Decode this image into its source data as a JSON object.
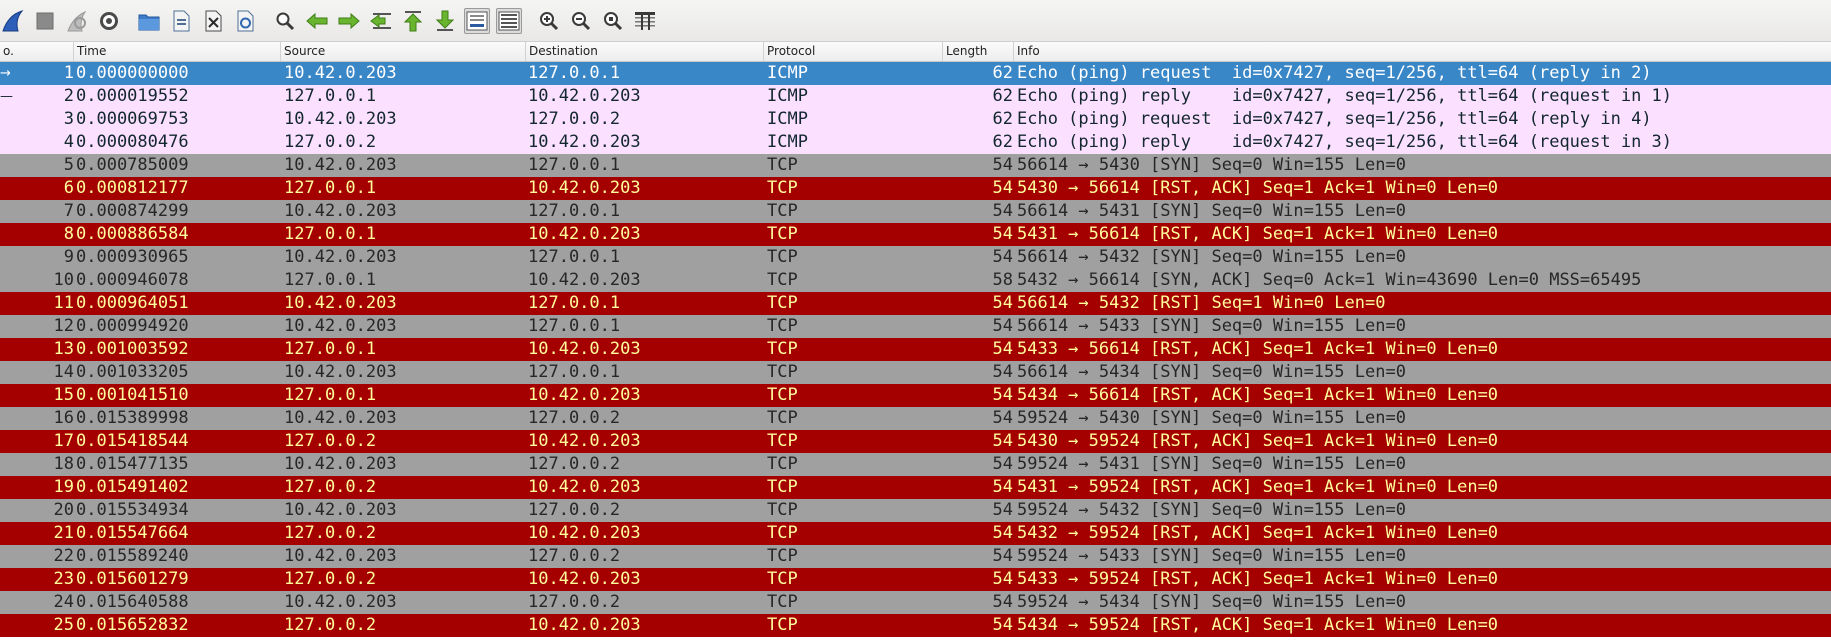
{
  "colors": {
    "selected_bg": "#3a87c8",
    "selected_fg": "#ffffff",
    "icmp_bg": "#fce0ff",
    "icmp_fg": "#12272e",
    "tcp_syn_bg": "#a0a0a0",
    "tcp_syn_fg": "#272727",
    "tcp_rst_bg": "#a40000",
    "tcp_rst_fg": "#fffc9c"
  },
  "toolbar": {
    "buttons": [
      {
        "icon": "shark-fin-start-icon"
      },
      {
        "icon": "stop-capture-icon"
      },
      {
        "icon": "restart-capture-icon"
      },
      {
        "icon": "capture-options-gear-icon"
      },
      {
        "icon": "open-file-folder-icon"
      },
      {
        "icon": "save-file-icon"
      },
      {
        "icon": "close-file-icon"
      },
      {
        "icon": "reload-file-icon"
      },
      {
        "icon": "find-packet-magnifier-icon"
      },
      {
        "icon": "go-back-arrow-icon"
      },
      {
        "icon": "go-forward-arrow-icon"
      },
      {
        "icon": "go-to-packet-icon"
      },
      {
        "icon": "go-to-first-packet-icon"
      },
      {
        "icon": "go-to-last-packet-icon"
      },
      {
        "icon": "auto-scroll-icon"
      },
      {
        "icon": "colorize-packet-list-icon"
      },
      {
        "icon": "zoom-in-icon"
      },
      {
        "icon": "zoom-out-icon"
      },
      {
        "icon": "normal-size-icon"
      },
      {
        "icon": "resize-columns-icon"
      }
    ]
  },
  "columns": [
    "o.",
    "Time",
    "Source",
    "Destination",
    "Protocol",
    "Length",
    "Info"
  ],
  "packets": [
    {
      "no": "1",
      "time": "0.000000000",
      "src": "10.42.0.203",
      "dst": "127.0.0.1",
      "proto": "ICMP",
      "len": "62",
      "info": "Echo (ping) request  id=0x7427, seq=1/256, ttl=64 (reply in 2)",
      "kind": "selected",
      "mark": "→"
    },
    {
      "no": "2",
      "time": "0.000019552",
      "src": "127.0.0.1",
      "dst": "10.42.0.203",
      "proto": "ICMP",
      "len": "62",
      "info": "Echo (ping) reply    id=0x7427, seq=1/256, ttl=64 (request in 1)",
      "kind": "icmp",
      "mark": "—"
    },
    {
      "no": "3",
      "time": "0.000069753",
      "src": "10.42.0.203",
      "dst": "127.0.0.2",
      "proto": "ICMP",
      "len": "62",
      "info": "Echo (ping) request  id=0x7427, seq=1/256, ttl=64 (reply in 4)",
      "kind": "icmp",
      "mark": ""
    },
    {
      "no": "4",
      "time": "0.000080476",
      "src": "127.0.0.2",
      "dst": "10.42.0.203",
      "proto": "ICMP",
      "len": "62",
      "info": "Echo (ping) reply    id=0x7427, seq=1/256, ttl=64 (request in 3)",
      "kind": "icmp",
      "mark": ""
    },
    {
      "no": "5",
      "time": "0.000785009",
      "src": "10.42.0.203",
      "dst": "127.0.0.1",
      "proto": "TCP",
      "len": "54",
      "info": "56614 → 5430 [SYN] Seq=0 Win=155 Len=0",
      "kind": "syn",
      "mark": ""
    },
    {
      "no": "6",
      "time": "0.000812177",
      "src": "127.0.0.1",
      "dst": "10.42.0.203",
      "proto": "TCP",
      "len": "54",
      "info": "5430 → 56614 [RST, ACK] Seq=1 Ack=1 Win=0 Len=0",
      "kind": "rst",
      "mark": ""
    },
    {
      "no": "7",
      "time": "0.000874299",
      "src": "10.42.0.203",
      "dst": "127.0.0.1",
      "proto": "TCP",
      "len": "54",
      "info": "56614 → 5431 [SYN] Seq=0 Win=155 Len=0",
      "kind": "syn",
      "mark": ""
    },
    {
      "no": "8",
      "time": "0.000886584",
      "src": "127.0.0.1",
      "dst": "10.42.0.203",
      "proto": "TCP",
      "len": "54",
      "info": "5431 → 56614 [RST, ACK] Seq=1 Ack=1 Win=0 Len=0",
      "kind": "rst",
      "mark": ""
    },
    {
      "no": "9",
      "time": "0.000930965",
      "src": "10.42.0.203",
      "dst": "127.0.0.1",
      "proto": "TCP",
      "len": "54",
      "info": "56614 → 5432 [SYN] Seq=0 Win=155 Len=0",
      "kind": "syn",
      "mark": ""
    },
    {
      "no": "10",
      "time": "0.000946078",
      "src": "127.0.0.1",
      "dst": "10.42.0.203",
      "proto": "TCP",
      "len": "58",
      "info": "5432 → 56614 [SYN, ACK] Seq=0 Ack=1 Win=43690 Len=0 MSS=65495",
      "kind": "syn",
      "mark": ""
    },
    {
      "no": "11",
      "time": "0.000964051",
      "src": "10.42.0.203",
      "dst": "127.0.0.1",
      "proto": "TCP",
      "len": "54",
      "info": "56614 → 5432 [RST] Seq=1 Win=0 Len=0",
      "kind": "rst",
      "mark": ""
    },
    {
      "no": "12",
      "time": "0.000994920",
      "src": "10.42.0.203",
      "dst": "127.0.0.1",
      "proto": "TCP",
      "len": "54",
      "info": "56614 → 5433 [SYN] Seq=0 Win=155 Len=0",
      "kind": "syn",
      "mark": ""
    },
    {
      "no": "13",
      "time": "0.001003592",
      "src": "127.0.0.1",
      "dst": "10.42.0.203",
      "proto": "TCP",
      "len": "54",
      "info": "5433 → 56614 [RST, ACK] Seq=1 Ack=1 Win=0 Len=0",
      "kind": "rst",
      "mark": ""
    },
    {
      "no": "14",
      "time": "0.001033205",
      "src": "10.42.0.203",
      "dst": "127.0.0.1",
      "proto": "TCP",
      "len": "54",
      "info": "56614 → 5434 [SYN] Seq=0 Win=155 Len=0",
      "kind": "syn",
      "mark": ""
    },
    {
      "no": "15",
      "time": "0.001041510",
      "src": "127.0.0.1",
      "dst": "10.42.0.203",
      "proto": "TCP",
      "len": "54",
      "info": "5434 → 56614 [RST, ACK] Seq=1 Ack=1 Win=0 Len=0",
      "kind": "rst",
      "mark": ""
    },
    {
      "no": "16",
      "time": "0.015389998",
      "src": "10.42.0.203",
      "dst": "127.0.0.2",
      "proto": "TCP",
      "len": "54",
      "info": "59524 → 5430 [SYN] Seq=0 Win=155 Len=0",
      "kind": "syn",
      "mark": ""
    },
    {
      "no": "17",
      "time": "0.015418544",
      "src": "127.0.0.2",
      "dst": "10.42.0.203",
      "proto": "TCP",
      "len": "54",
      "info": "5430 → 59524 [RST, ACK] Seq=1 Ack=1 Win=0 Len=0",
      "kind": "rst",
      "mark": ""
    },
    {
      "no": "18",
      "time": "0.015477135",
      "src": "10.42.0.203",
      "dst": "127.0.0.2",
      "proto": "TCP",
      "len": "54",
      "info": "59524 → 5431 [SYN] Seq=0 Win=155 Len=0",
      "kind": "syn",
      "mark": ""
    },
    {
      "no": "19",
      "time": "0.015491402",
      "src": "127.0.0.2",
      "dst": "10.42.0.203",
      "proto": "TCP",
      "len": "54",
      "info": "5431 → 59524 [RST, ACK] Seq=1 Ack=1 Win=0 Len=0",
      "kind": "rst",
      "mark": ""
    },
    {
      "no": "20",
      "time": "0.015534934",
      "src": "10.42.0.203",
      "dst": "127.0.0.2",
      "proto": "TCP",
      "len": "54",
      "info": "59524 → 5432 [SYN] Seq=0 Win=155 Len=0",
      "kind": "syn",
      "mark": ""
    },
    {
      "no": "21",
      "time": "0.015547664",
      "src": "127.0.0.2",
      "dst": "10.42.0.203",
      "proto": "TCP",
      "len": "54",
      "info": "5432 → 59524 [RST, ACK] Seq=1 Ack=1 Win=0 Len=0",
      "kind": "rst",
      "mark": ""
    },
    {
      "no": "22",
      "time": "0.015589240",
      "src": "10.42.0.203",
      "dst": "127.0.0.2",
      "proto": "TCP",
      "len": "54",
      "info": "59524 → 5433 [SYN] Seq=0 Win=155 Len=0",
      "kind": "syn",
      "mark": ""
    },
    {
      "no": "23",
      "time": "0.015601279",
      "src": "127.0.0.2",
      "dst": "10.42.0.203",
      "proto": "TCP",
      "len": "54",
      "info": "5433 → 59524 [RST, ACK] Seq=1 Ack=1 Win=0 Len=0",
      "kind": "rst",
      "mark": ""
    },
    {
      "no": "24",
      "time": "0.015640588",
      "src": "10.42.0.203",
      "dst": "127.0.0.2",
      "proto": "TCP",
      "len": "54",
      "info": "59524 → 5434 [SYN] Seq=0 Win=155 Len=0",
      "kind": "syn",
      "mark": ""
    },
    {
      "no": "25",
      "time": "0.015652832",
      "src": "127.0.0.2",
      "dst": "10.42.0.203",
      "proto": "TCP",
      "len": "54",
      "info": "5434 → 59524 [RST, ACK] Seq=1 Ack=1 Win=0 Len=0",
      "kind": "rst",
      "mark": ""
    }
  ]
}
